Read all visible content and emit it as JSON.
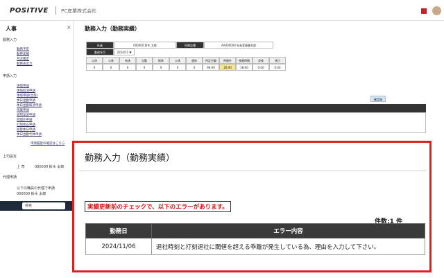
{
  "header": {
    "logo": "POSITIVE",
    "company": "PC産業株式会社"
  },
  "sidebar": {
    "title": "人事",
    "close": "×",
    "sections": [
      {
        "label": "勤務入力",
        "links": [
          "勤務予定",
          "勤務実績",
          "月次確定",
          "勤務表出力"
        ]
      },
      {
        "label": "申請入力",
        "links": [
          "休暇申請",
          "休暇取消申請",
          "休暇申請(出張)",
          "休日出勤申請",
          "休日出勤取消申請",
          "残業申請",
          "遅刻早退申請",
          "時間外申請",
          "打刻修正申請",
          "振替休日申請",
          "休日出勤代休申請"
        ]
      },
      {
        "label": "上司設定",
        "links": [
          "上 司",
          "000000 鈴木 太郎"
        ]
      },
      {
        "label": "代理申請",
        "links": [
          "以下の職員の代理で申請",
          "000000 鈴木 太郎"
        ]
      }
    ],
    "more_link": "申請履歴の確認はこちら"
  },
  "page": {
    "heading": "勤務入力（勤務実績）"
  },
  "background": {
    "row1": [
      "社員",
      "000000 鈴木 太郎",
      "所属店舗",
      "AA000000 社長室事業本部"
    ],
    "month_label": "勤務年月",
    "month_value": "2024/11 ▼",
    "summary_headers": [
      "公休",
      "公休",
      "有休",
      "欠勤",
      "振休",
      "公休",
      "週休",
      "所定労働",
      "時間外",
      "夜間時間",
      "深夜",
      "休日"
    ],
    "summary_values": [
      "0",
      "0",
      "0",
      "0",
      "0",
      "0",
      "0",
      "96:00",
      "28:00",
      "28:00",
      "0:00",
      "0:00"
    ],
    "button": "確定後"
  },
  "taskbar": {
    "search": "検索"
  },
  "dialog": {
    "title": "勤務入力（勤務実績）",
    "error_message": "実績更新前のチェックで、以下のエラーがあります。",
    "count": "件数:1 件",
    "table": {
      "headers": [
        "勤務日",
        "エラー内容"
      ],
      "rows": [
        [
          "2024/11/06",
          "退社時刻と打刻退社に閾値を超える乖離が発生している為、理由を入力して下さい。"
        ]
      ]
    }
  }
}
